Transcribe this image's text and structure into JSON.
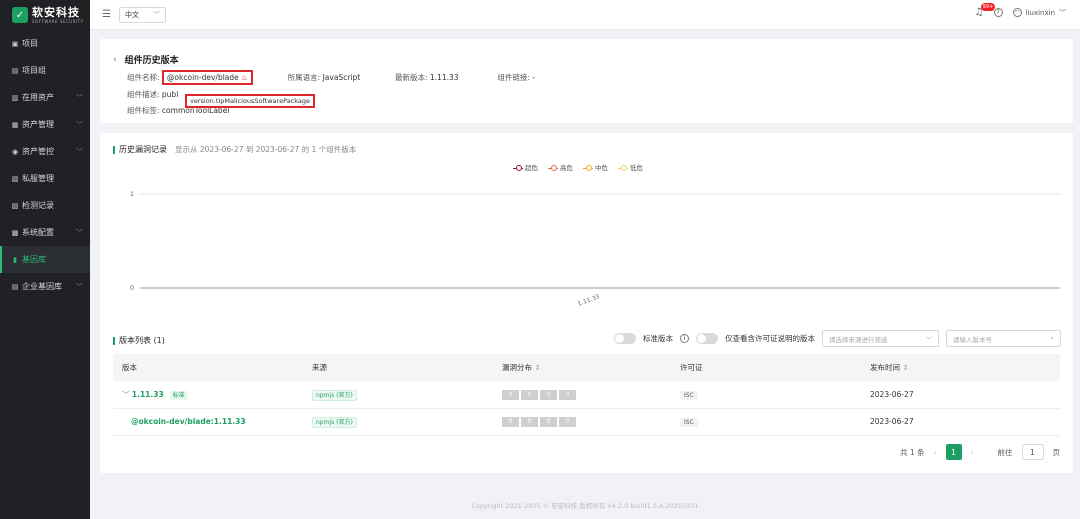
{
  "brand": {
    "cn": "软安科技",
    "en": "SOFTWARE SECURITY"
  },
  "sidebar": {
    "items": [
      {
        "label": "项目",
        "icon": "folder-icon"
      },
      {
        "label": "项目组",
        "icon": "group-icon"
      },
      {
        "label": "在用资产",
        "icon": "asset-icon"
      },
      {
        "label": "资产管理",
        "icon": "manage-icon"
      },
      {
        "label": "资产管控",
        "icon": "control-icon"
      },
      {
        "label": "私服管理",
        "icon": "server-icon"
      },
      {
        "label": "检测记录",
        "icon": "record-icon"
      },
      {
        "label": "系统配置",
        "icon": "settings-icon"
      },
      {
        "label": "基因库",
        "icon": "library-icon"
      },
      {
        "label": "企业基因库",
        "icon": "enterprise-icon"
      }
    ]
  },
  "header": {
    "language": "中文",
    "badge": "99+",
    "user": "liuxinxin"
  },
  "component": {
    "page_title": "组件历史版本",
    "name_label": "组件名称:",
    "name_value": "@okcoin-dev/blade",
    "lang_label": "所属语言:",
    "lang_value": "JavaScript",
    "latest_label": "最新版本:",
    "latest_value": "1.11.33",
    "link_label": "组件链接:",
    "link_value": "-",
    "desc_label": "组件描述:",
    "desc_value": "publ",
    "tag_label": "组件标签:",
    "tag_value": "commonToolLabel",
    "tooltip": "version.tipMaliciousSoftwarePackage"
  },
  "history": {
    "title": "历史漏洞记录",
    "subtitle": "显示从 2023-06-27 到 2023-06-27 的 1 个组件版本",
    "legend": [
      {
        "label": "超危",
        "color": "#8b1a2b"
      },
      {
        "label": "高危",
        "color": "#e8684a"
      },
      {
        "label": "中危",
        "color": "#f6a623"
      },
      {
        "label": "低危",
        "color": "#f6d06a"
      }
    ]
  },
  "chart_data": {
    "type": "line",
    "x": [
      "1.11.33"
    ],
    "series": [
      {
        "name": "超危",
        "values": [
          0
        ]
      },
      {
        "name": "高危",
        "values": [
          0
        ]
      },
      {
        "name": "中危",
        "values": [
          0
        ]
      },
      {
        "name": "低危",
        "values": [
          0
        ]
      }
    ],
    "ylim": [
      0,
      1
    ],
    "yticks": [
      "0",
      "1"
    ],
    "xtick_labels": [
      "1.11.33"
    ],
    "legend_position": "top-center",
    "grid": true
  },
  "versions": {
    "title": "版本列表 (1)",
    "std_toggle_label": "标准版本",
    "license_toggle_label": "仅查看含许可证说明的版本",
    "source_placeholder": "请选择来源进行筛选",
    "version_placeholder": "请输入版本号",
    "columns": [
      "版本",
      "来源",
      "漏洞分布",
      "许可证",
      "发布时间"
    ],
    "rows": [
      {
        "version": "1.11.33",
        "tag": "标准",
        "source": "npmjs (官方)",
        "vulns": [
          "0",
          "0",
          "0",
          "0"
        ],
        "license": "ISC",
        "date": "2023-06-27"
      },
      {
        "version": "@okcoin-dev/blade:1.11.33",
        "tag": "",
        "source": "npmjs (官方)",
        "vulns": [
          "0",
          "0",
          "0",
          "0"
        ],
        "license": "ISC",
        "date": "2023-06-27"
      }
    ]
  },
  "pagination": {
    "total": "共 1 条",
    "current": "1",
    "goto_label": "前往",
    "goto_value": "1",
    "page_suffix": "页"
  },
  "footer": "Copyright 2021-2025 © 软安科技 版权所有 V4.2.0.build1.0.A-20250331"
}
